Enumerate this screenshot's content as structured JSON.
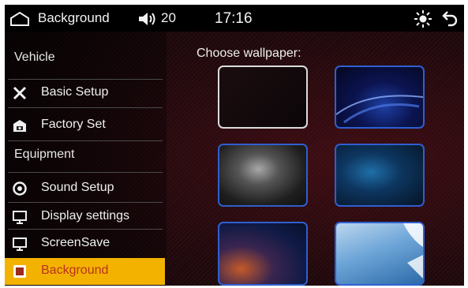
{
  "topbar": {
    "title": "Background",
    "volume": "20",
    "time": "17:16"
  },
  "sidebar": {
    "category_vehicle": "Vehicle",
    "basic_setup": "Basic Setup",
    "factory_set": "Factory Set",
    "category_equipment": "Equipment",
    "sound_setup": "Sound Setup",
    "display_settings": "Display settings",
    "screensave": "ScreenSave",
    "background": "Background"
  },
  "main": {
    "title": "Choose wallpaper:",
    "selected_index": 0
  },
  "colors": {
    "accent": "#f3b200",
    "thumb_border": "#2f5fd0",
    "selected_border": "#dcdcdc"
  }
}
